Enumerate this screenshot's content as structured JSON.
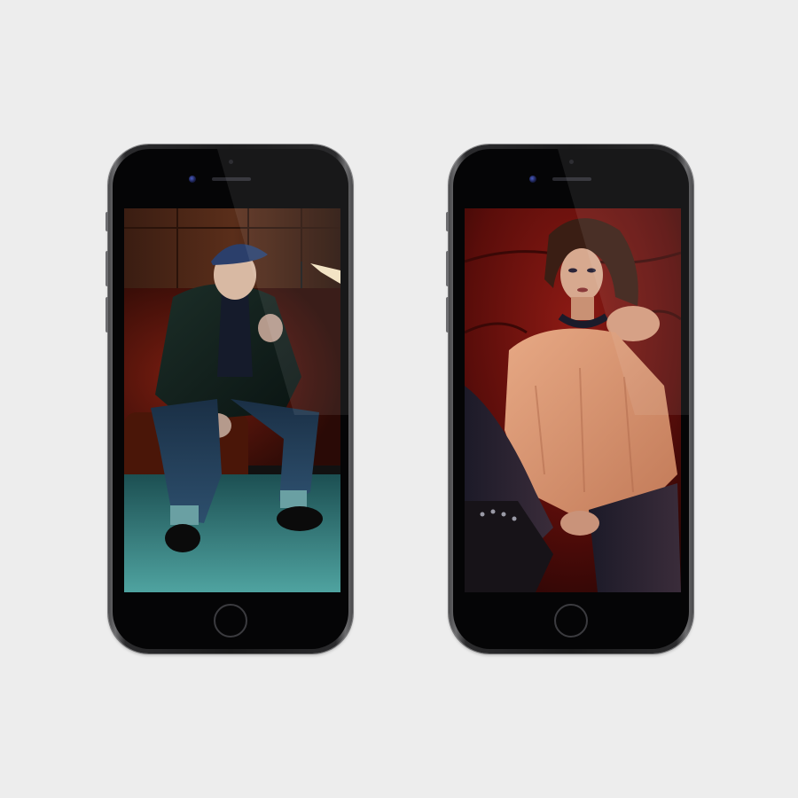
{
  "scene": {
    "background_color": "#ededed"
  },
  "phones": [
    {
      "position": "left",
      "photo": "man-seated-on-leather-couch",
      "accent_color": "#1f6a70"
    },
    {
      "position": "right",
      "photo": "woman-in-knit-sweater-on-red-leather-chair",
      "accent_color": "#7a1210"
    }
  ],
  "icons": {
    "camera": "front-camera-icon",
    "home": "home-button-icon"
  }
}
